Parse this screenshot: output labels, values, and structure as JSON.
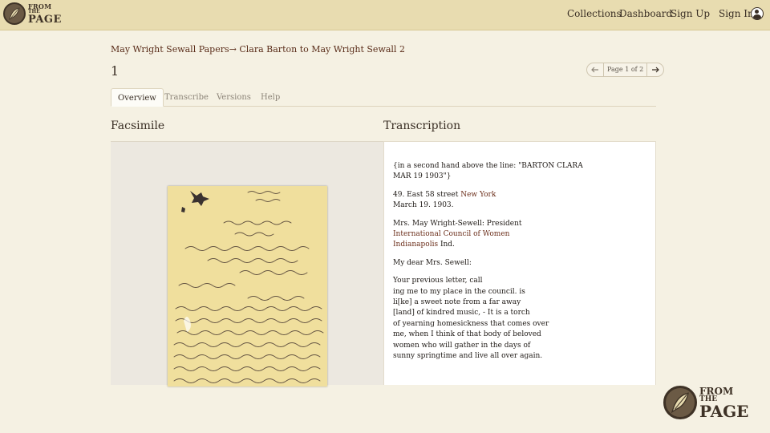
{
  "header": {
    "logo": {
      "line1": "FROM",
      "line2": "THE",
      "line3": "PAGE"
    },
    "nav": {
      "collections": "Collections",
      "dashboard": "Dashboard",
      "sign_up": "Sign Up",
      "sign_in": "Sign In"
    }
  },
  "breadcrumb": {
    "collection": "May Wright Sewall Papers",
    "separator": "→",
    "work": "Clara Barton to May Wright Sewall 2"
  },
  "page_title": "1",
  "pager": {
    "prev_icon": "arrow-left-icon",
    "label": "Page 1 of 2",
    "next_icon": "arrow-right-icon"
  },
  "tabs": [
    {
      "label": "Overview",
      "active": true
    },
    {
      "label": "Transcribe",
      "active": false
    },
    {
      "label": "Versions",
      "active": false
    },
    {
      "label": "Help",
      "active": false
    }
  ],
  "sections": {
    "facsimile": "Facsimile",
    "transcription": "Transcription"
  },
  "transcription": {
    "note": "{in a second hand above the line: \"BARTON CLARA",
    "note2": "MAR 19 1903\"}",
    "address_street": "49. East 58 street ",
    "address_city": "New York",
    "address_date": "March 19. 1903.",
    "recipient_name": "Mrs. May Wright-Sewell: President",
    "recipient_org": "International Council of Women",
    "recipient_city": "Indianapolis",
    "recipient_state": " Ind.",
    "salutation": "My dear Mrs. Sewell:",
    "body": [
      "Your previous letter, call",
      "ing me to my place in the council. is",
      "li[ke] a sweet note from a far away",
      "[land] of kindred music, - It is a torch",
      "of yearning homesickness that comes over",
      "me, when I think of that body of beloved",
      "women who will gather in the days of",
      "sunny springtime and live all over again."
    ]
  },
  "footer_logo": {
    "line1": "FROM",
    "line2": "THE",
    "line3": "PAGE"
  },
  "colors": {
    "header_bg": "#e8dcb0",
    "page_bg": "#f5f1e3",
    "link": "#6b2e1a",
    "paper": "#f0df9d"
  }
}
